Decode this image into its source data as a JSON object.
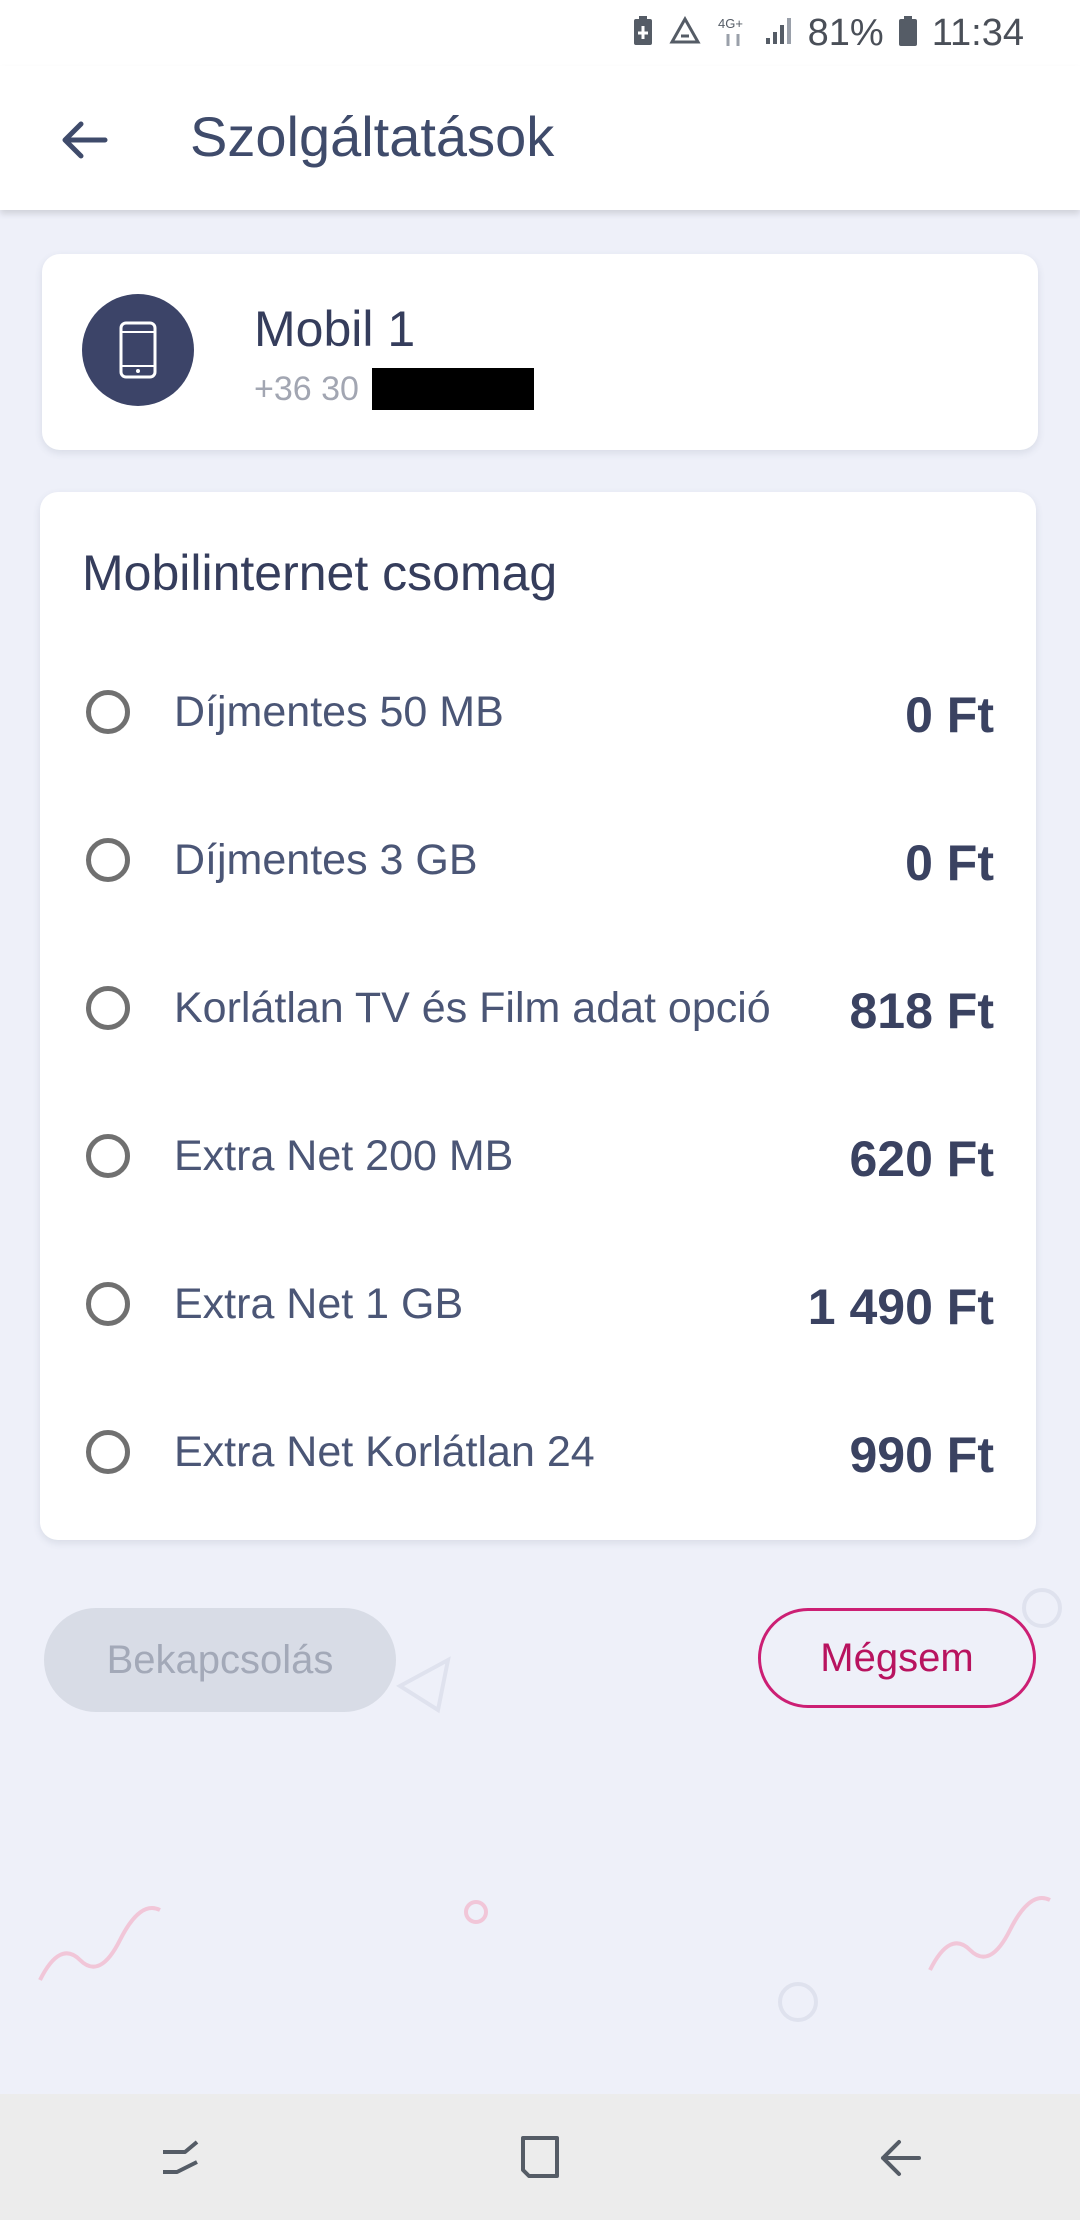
{
  "status_bar": {
    "battery_percent": "81%",
    "time": "11:34",
    "network": "4G+",
    "icons": [
      "battery-saver-icon",
      "sync-icon",
      "network-4g-icon",
      "signal-icon",
      "battery-icon"
    ]
  },
  "app_bar": {
    "title": "Szolgáltatások",
    "back_icon": "arrow-left-icon"
  },
  "account": {
    "name": "Mobil 1",
    "number_prefix": "+36 30",
    "avatar_icon": "smartphone-icon"
  },
  "package": {
    "title": "Mobilinternet csomag",
    "options": [
      {
        "label": "Díjmentes 50 MB",
        "price": "0 Ft",
        "selected": false
      },
      {
        "label": "Díjmentes 3 GB",
        "price": "0 Ft",
        "selected": false
      },
      {
        "label": "Korlátlan TV és Film adat opció",
        "price": "818 Ft",
        "selected": false
      },
      {
        "label": "Extra Net 200 MB",
        "price": "620 Ft",
        "selected": false
      },
      {
        "label": "Extra Net 1 GB",
        "price": "1 490 Ft",
        "selected": false
      },
      {
        "label": "Extra Net Korlátlan 24",
        "price": "990 Ft",
        "selected": false
      }
    ]
  },
  "actions": {
    "enable_label": "Bekapcsolás",
    "cancel_label": "Mégsem"
  },
  "colors": {
    "primary": "#3c4468",
    "accent": "#cc1f74",
    "background": "#eef0f9"
  },
  "nav_bar": {
    "icons": [
      "recents-icon",
      "home-icon",
      "back-icon"
    ]
  }
}
